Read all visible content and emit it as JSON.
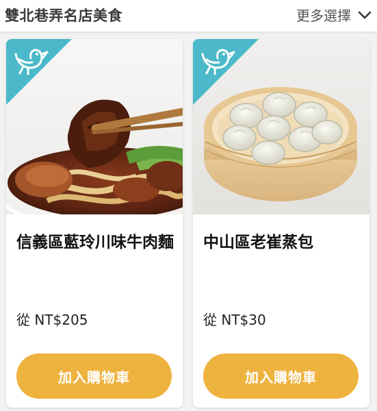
{
  "header": {
    "title": "雙北巷弄名店美食",
    "more_label": "更多選擇"
  },
  "products": [
    {
      "name": "信義區藍玲川味牛肉麵",
      "price": "從 NT$205",
      "button_label": "加入購物車"
    },
    {
      "name": "中山區老崔蒸包",
      "price": "從 NT$30",
      "button_label": "加入購物車"
    }
  ],
  "colors": {
    "badge": "#4bb9c9",
    "button": "#eeb23f",
    "button_text": "#ffffff"
  },
  "icons": {
    "more": "chevron-down-icon",
    "badge": "bird-icon"
  }
}
